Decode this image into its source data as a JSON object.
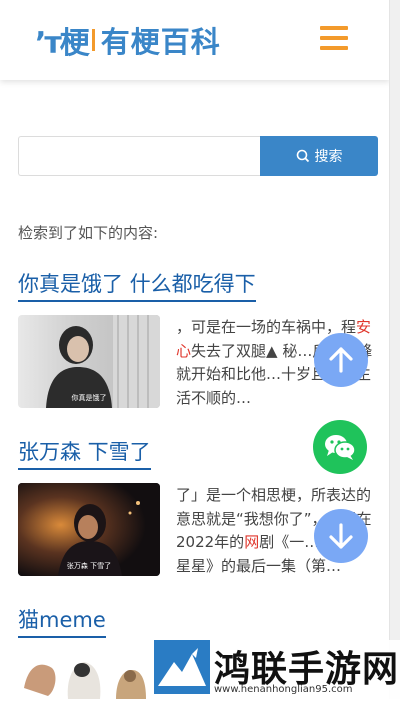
{
  "header": {
    "logo_mark": "ʼᴛ梗",
    "logo_text": "有梗百科"
  },
  "search": {
    "placeholder": "",
    "button_label": "搜索"
  },
  "results_label": "检索到了如下的内容:",
  "results": [
    {
      "title": "你真是饿了 什么都吃得下",
      "thumb_caption": "你真是饿了",
      "excerpt_pre": "，可是在一场的车祸中，程",
      "excerpt_hl": "安心",
      "excerpt_post": "失去了双腿▲ 秘…后来秦峰就开始和比他…十岁且同样生活不顺的…"
    },
    {
      "title": "张万森 下雪了",
      "thumb_caption": "张万森 下雪了",
      "excerpt_pre": "了」是一个相思梗，所表达的意思就是“我想你了”，出现在2022年的",
      "excerpt_hl": "网",
      "excerpt_post": "剧《一…的》亮星星》的最后一集（第…"
    }
  ],
  "third_title": "猫meme",
  "watermark": {
    "title": "鸿联手游网",
    "url": "www.henanhonglian95.com"
  },
  "colors": {
    "brand_blue": "#3a86c8",
    "accent_orange": "#f39a2b",
    "link_blue": "#1a5fa8",
    "highlight_red": "#e0362c",
    "fab_blue": "#7aa8f5",
    "wechat_green": "#1fc35b"
  },
  "icons": [
    "menu-icon",
    "search-icon",
    "arrow-up-icon",
    "wechat-icon",
    "arrow-down-icon"
  ]
}
